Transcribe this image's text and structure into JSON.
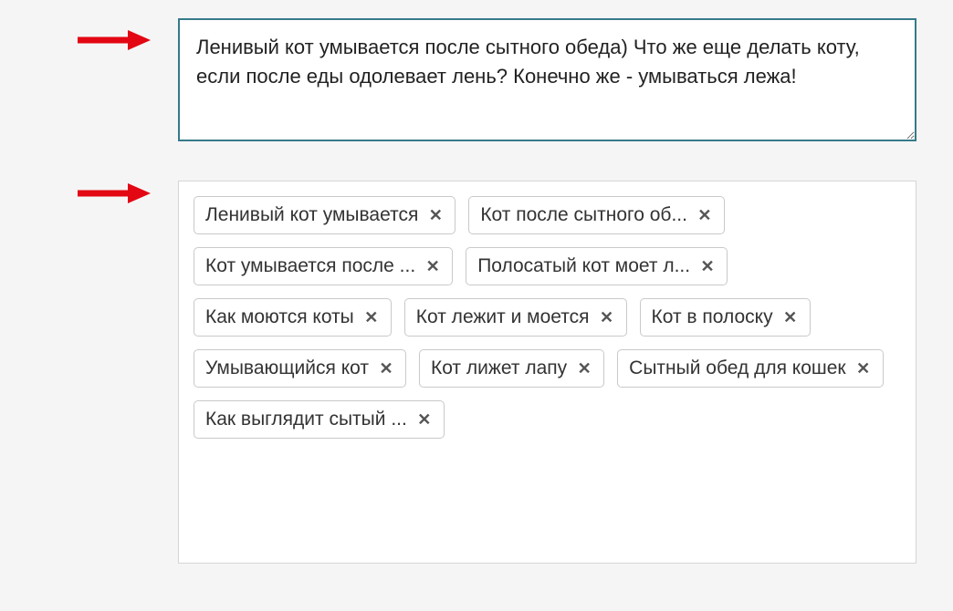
{
  "description": {
    "text": "Ленивый кот умывается после сытного обеда) Что же еще делать коту, если после еды одолевает лень? Конечно же - умываться лежа!"
  },
  "tags": [
    {
      "label": "Ленивый кот умывается"
    },
    {
      "label": "Кот после сытного об..."
    },
    {
      "label": "Кот умывается после ..."
    },
    {
      "label": "Полосатый кот моет л..."
    },
    {
      "label": "Как моются коты"
    },
    {
      "label": "Кот лежит и моется"
    },
    {
      "label": "Кот в полоску"
    },
    {
      "label": "Умывающийся кот"
    },
    {
      "label": "Кот лижет лапу"
    },
    {
      "label": "Сытный обед для кошек"
    },
    {
      "label": "Как выглядит сытый ..."
    }
  ],
  "colors": {
    "accent": "#367a8a",
    "arrow": "#e30613"
  }
}
